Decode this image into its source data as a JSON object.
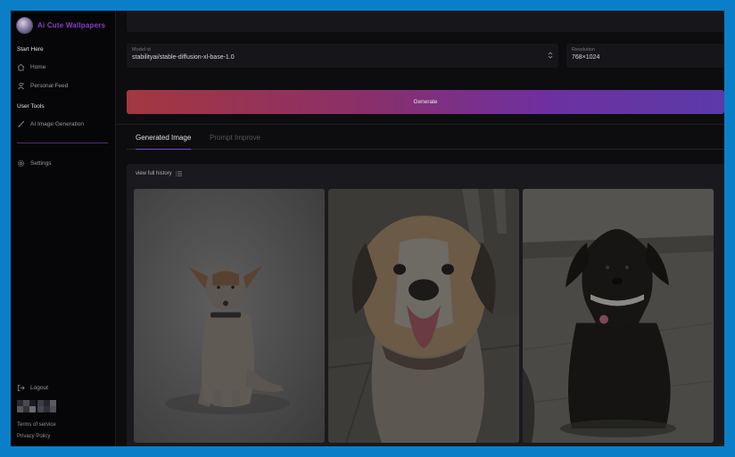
{
  "app": {
    "name": "Ai Cute Wallpapers"
  },
  "sidebar": {
    "section_start": "Start Here",
    "items_start": [
      {
        "label": "Home",
        "icon": "home-icon"
      },
      {
        "label": "Personal Feed",
        "icon": "feed-icon"
      }
    ],
    "section_tools": "User Tools",
    "items_tools": [
      {
        "label": "AI Image Generation",
        "icon": "brush-icon"
      }
    ],
    "settings": {
      "label": "Settings",
      "icon": "gear-icon"
    },
    "logout": {
      "label": "Logout",
      "icon": "logout-icon"
    },
    "terms": "Terms of service",
    "privacy": "Privacy Policy"
  },
  "form": {
    "model_label": "Model id",
    "model_value": "stabilityai/stable-diffusion-xl-base-1.0",
    "resolution_label": "Resolution",
    "resolution_value": "768×1024",
    "generate_label": "Generate"
  },
  "tabs": {
    "generated": "Generated Image",
    "prompt_improve": "Prompt Improve"
  },
  "results": {
    "history_label": "view full history"
  },
  "colors": {
    "accent": "#7b4cc3",
    "brand_text": "#8a3fc4",
    "generate_start": "#a43840",
    "generate_end": "#5b3aa8"
  }
}
